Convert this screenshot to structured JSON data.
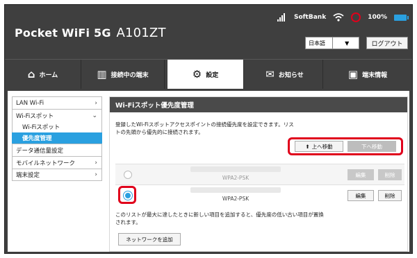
{
  "header": {
    "logo_text": "Pocket WiFi 5G",
    "model": "A101ZT",
    "carrier": "SoftBank",
    "battery": "100%",
    "language": "日本語",
    "logout": "ログアウト"
  },
  "nav": {
    "tabs": [
      {
        "label": "ホーム",
        "icon": "home-icon"
      },
      {
        "label": "接続中の端末",
        "icon": "devices-icon"
      },
      {
        "label": "設定",
        "icon": "gear-icon",
        "active": true
      },
      {
        "label": "お知らせ",
        "icon": "mail-icon"
      },
      {
        "label": "端末情報",
        "icon": "info-icon"
      }
    ]
  },
  "sidebar": {
    "items": [
      {
        "label": "LAN Wi-Fi"
      },
      {
        "label": "Wi-Fiスポット"
      },
      {
        "label": "Wi-Fiスポット"
      },
      {
        "label": "優先度管理"
      },
      {
        "label": "データ通信量設定"
      },
      {
        "label": "モバイルネットワーク"
      },
      {
        "label": "端末設定"
      }
    ]
  },
  "content": {
    "title": "Wi-Fiスポット優先度管理",
    "description": "登録したWi-Fiスポットアクセスポイントの接続優先度を設定できます。リストの先頭から優先的に接続されます。",
    "move_up": "上へ移動",
    "move_down": "下へ移動",
    "rows": [
      {
        "security": "WPA2-PSK",
        "edit": "編集",
        "delete": "削除"
      },
      {
        "security": "WPA2-PSK",
        "edit": "編集",
        "delete": "削除"
      }
    ],
    "footer_note": "このリストが最大に達したときに新しい項目を追加すると、優先度の低い古い項目が置換されます。",
    "add_network": "ネットワークを追加"
  },
  "colors": {
    "accent": "#2aa0e0",
    "highlight": "#e0001b",
    "header_bg": "#3f3f3f"
  }
}
